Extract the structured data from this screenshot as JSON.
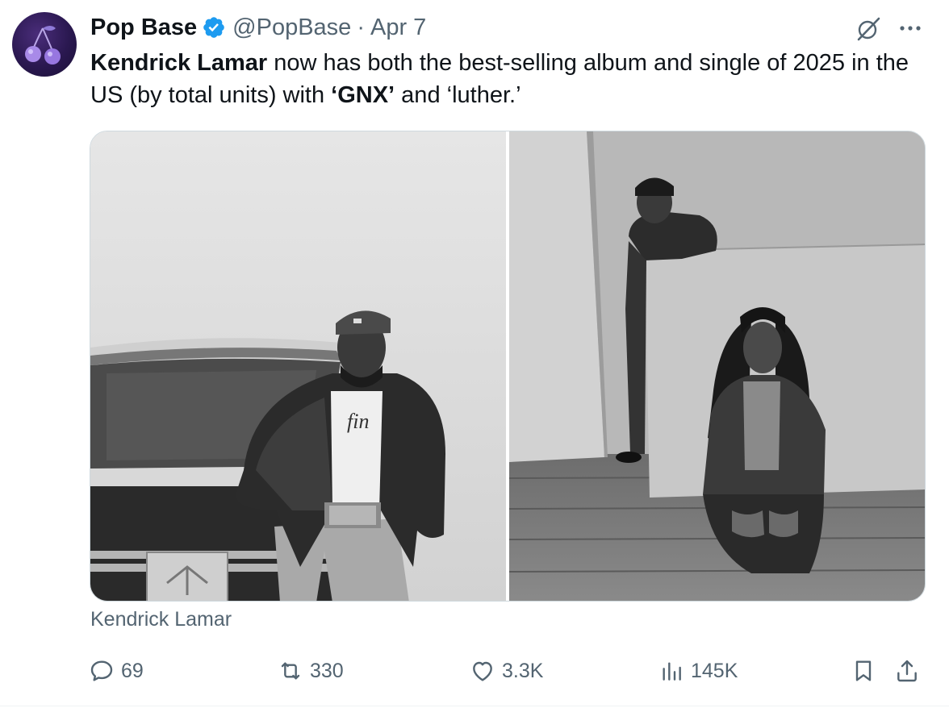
{
  "author": {
    "display_name": "Pop Base",
    "handle": "@PopBase",
    "separator": "·",
    "date": "Apr 7",
    "avatar_icon": "cherry-icon",
    "verified_color": "#1d9bf0"
  },
  "tweet": {
    "segments": [
      {
        "text": "Kendrick Lamar",
        "bold": true
      },
      {
        "text": " now has both the best-selling album and single of 2025 in the US (by total units) with ",
        "bold": false
      },
      {
        "text": "‘GNX’",
        "bold": true
      },
      {
        "text": " and ‘luther.’",
        "bold": false
      }
    ]
  },
  "media": {
    "caption": "Kendrick Lamar",
    "images": [
      {
        "alt": "Kendrick Lamar leaning against a car, black and white photo"
      },
      {
        "alt": "Kendrick Lamar and SZA posing in a studio, black and white photo"
      }
    ]
  },
  "actions": {
    "reply_count": "69",
    "retweet_count": "330",
    "like_count": "3.3K",
    "view_count": "145K"
  },
  "colors": {
    "text_primary": "#0f1419",
    "text_secondary": "#536471",
    "accent": "#1d9bf0",
    "border": "#cfd9de"
  }
}
